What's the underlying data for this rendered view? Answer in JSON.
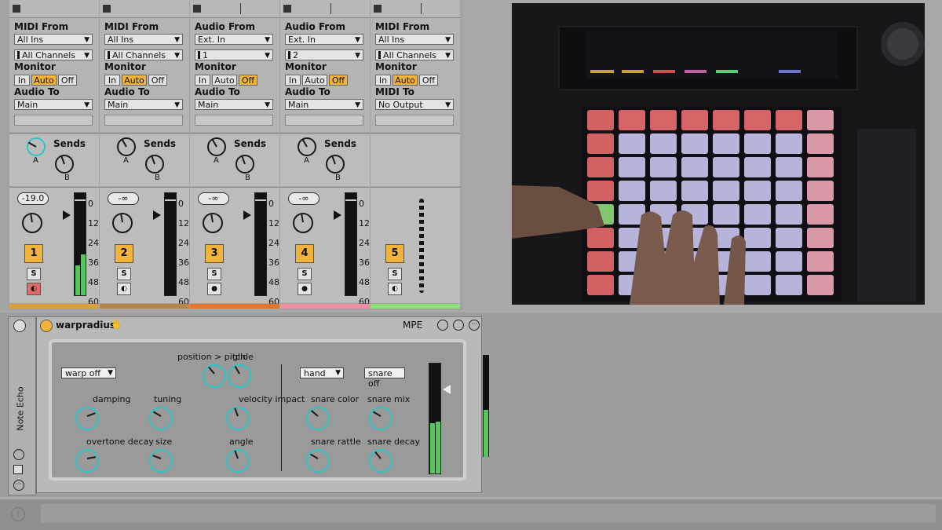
{
  "tracks": [
    {
      "midi_label": "MIDI From",
      "from": "All Ins",
      "channel": "All Channels",
      "monitor": "Monitor",
      "mon_active": "Auto",
      "audio_to_label": "Audio To",
      "to": "Main",
      "vol": "-19.0",
      "num": "1",
      "color": "#d9a03a",
      "rec_color": "red"
    },
    {
      "midi_label": "MIDI From",
      "from": "All Ins",
      "channel": "All Channels",
      "monitor": "Monitor",
      "mon_active": "Auto",
      "audio_to_label": "Audio To",
      "to": "Main",
      "vol": "-∞",
      "num": "2",
      "color": "#b7854a",
      "rec_color": ""
    },
    {
      "midi_label": "Audio From",
      "from": "Ext. In",
      "channel": "1",
      "monitor": "Monitor",
      "mon_active": "Off",
      "audio_to_label": "Audio To",
      "to": "Main",
      "vol": "-∞",
      "num": "3",
      "color": "#e8742c",
      "rec_color": ""
    },
    {
      "midi_label": "Audio From",
      "from": "Ext. In",
      "channel": "2",
      "monitor": "Monitor",
      "mon_active": "Off",
      "audio_to_label": "Audio To",
      "to": "Main",
      "vol": "-∞",
      "num": "4",
      "color": "#f08fa3",
      "rec_color": ""
    },
    {
      "midi_label": "MIDI From",
      "from": "All Ins",
      "channel": "All Channels",
      "monitor": "Monitor",
      "mon_active": "Auto",
      "audio_to_label": "MIDI To",
      "to": "No Output",
      "vol": "",
      "num": "5",
      "color": "#8fe07a",
      "rec_color": ""
    }
  ],
  "mon_in": "In",
  "mon_auto": "Auto",
  "mon_off": "Off",
  "sends_label": "Sends",
  "send_a": "A",
  "send_b": "B",
  "solo": "S",
  "scale": [
    "0",
    "12",
    "24",
    "36",
    "48",
    "60"
  ],
  "device": {
    "name": "warpradius",
    "mpe": "MPE",
    "sidebar": "Note Echo",
    "warp": "warp off",
    "hand": "hand",
    "snare": "snare off",
    "labels": {
      "position_pitch": "position > pitch",
      "glide": "glide",
      "damping": "damping",
      "tuning": "tuning",
      "velocity_impact": "velocity impact",
      "overtone_decay": "overtone decay",
      "size": "size",
      "angle": "angle",
      "snare_color": "snare color",
      "snare_mix": "snare mix",
      "snare_rattle": "snare rattle",
      "snare_decay": "snare decay"
    }
  },
  "colors": {
    "accent": "#f2b33a",
    "teal": "#2ec4c4",
    "meter": "#52c85a"
  }
}
